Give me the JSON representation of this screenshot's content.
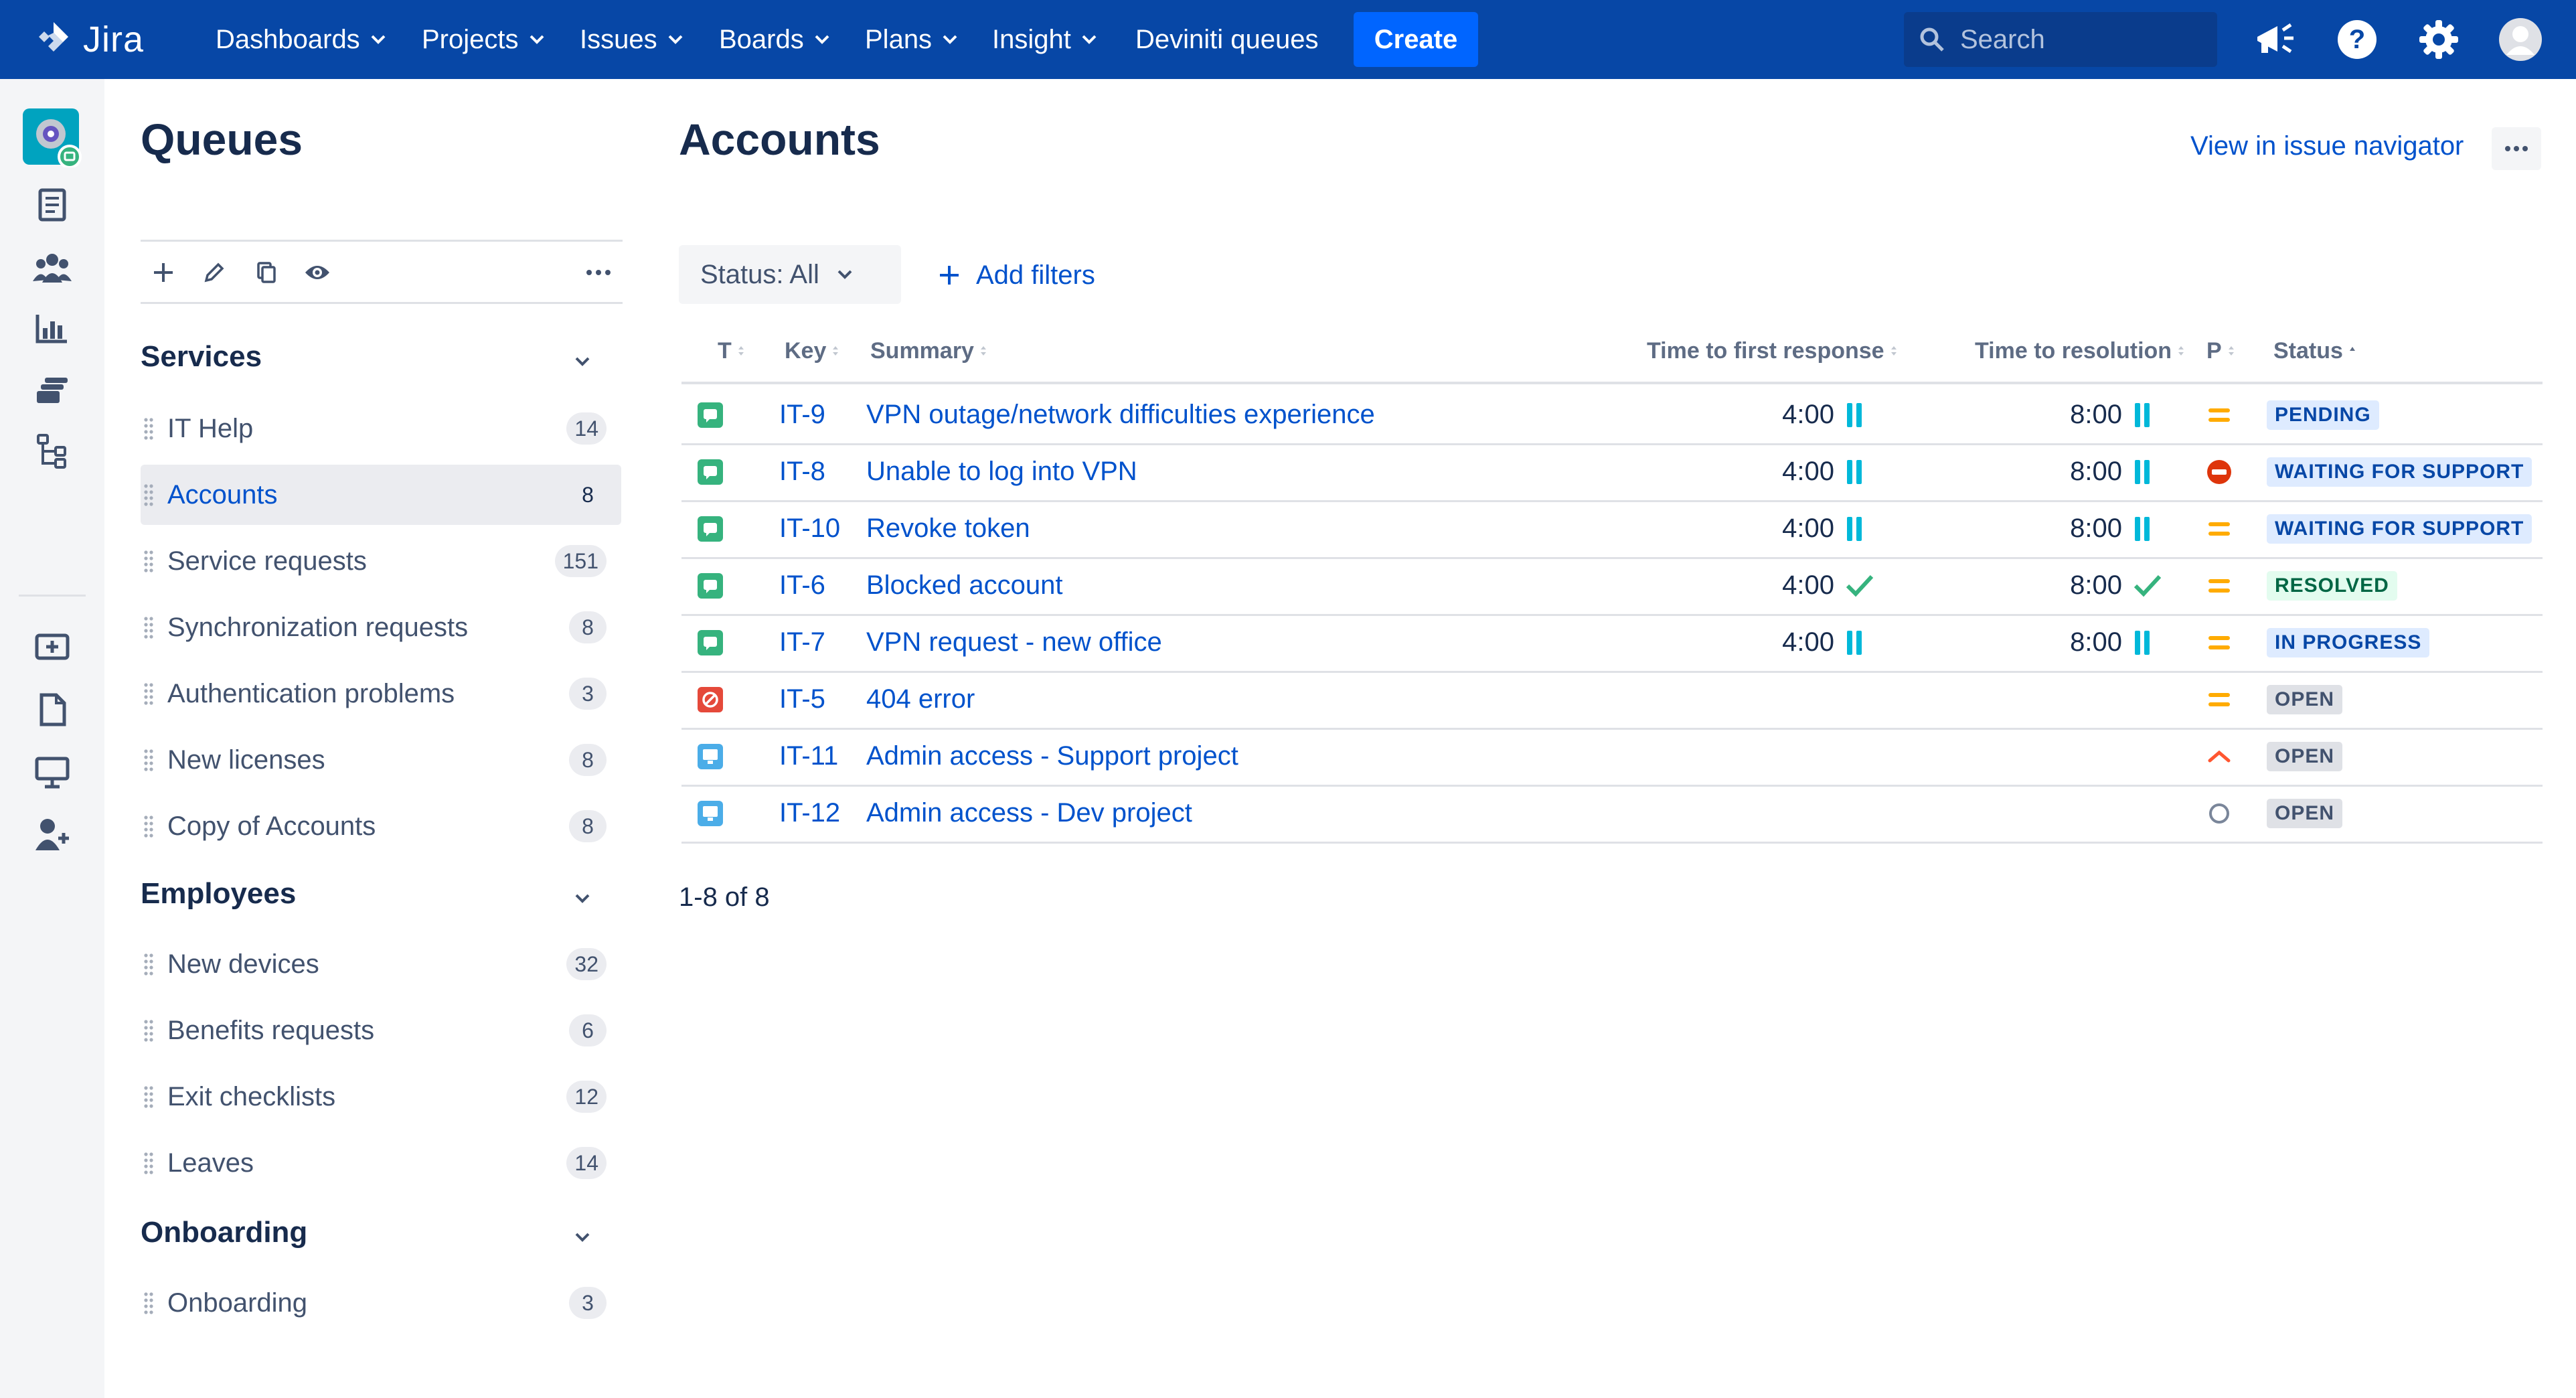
{
  "topnav": {
    "logo_text": "Jira",
    "items": [
      "Dashboards",
      "Projects",
      "Issues",
      "Boards",
      "Plans",
      "Insight"
    ],
    "queues_link": "Deviniti queues",
    "create_label": "Create",
    "search_placeholder": "Search"
  },
  "queues_panel": {
    "title": "Queues",
    "groups": [
      {
        "name": "Services",
        "items": [
          {
            "label": "IT Help",
            "count": "14"
          },
          {
            "label": "Accounts",
            "count": "8",
            "selected": true
          },
          {
            "label": "Service requests",
            "count": "151"
          },
          {
            "label": "Synchronization requests",
            "count": "8"
          },
          {
            "label": "Authentication problems",
            "count": "3"
          },
          {
            "label": "New licenses",
            "count": "8"
          },
          {
            "label": "Copy of Accounts",
            "count": "8"
          }
        ]
      },
      {
        "name": "Employees",
        "items": [
          {
            "label": "New devices",
            "count": "32"
          },
          {
            "label": "Benefits requests",
            "count": "6"
          },
          {
            "label": "Exit checklists",
            "count": "12"
          },
          {
            "label": "Leaves",
            "count": "14"
          }
        ]
      },
      {
        "name": "Onboarding",
        "items": [
          {
            "label": "Onboarding",
            "count": "3"
          }
        ]
      }
    ]
  },
  "main": {
    "title": "Accounts",
    "view_link": "View in issue navigator",
    "status_filter": "Status: All",
    "add_filters": "Add filters",
    "columns": {
      "type": "T",
      "key": "Key",
      "summary": "Summary",
      "first_response": "Time to first response",
      "resolution": "Time to resolution",
      "priority": "P",
      "status": "Status"
    },
    "rows": [
      {
        "type": "service-request",
        "key": "IT-9",
        "summary": "VPN outage/network difficulties experience",
        "first_response": "4:00",
        "fr_state": "paused",
        "resolution": "8:00",
        "res_state": "paused",
        "priority": "medium",
        "status": "PENDING",
        "status_kind": "blue"
      },
      {
        "type": "service-request",
        "key": "IT-8",
        "summary": "Unable to log into VPN",
        "first_response": "4:00",
        "fr_state": "paused",
        "resolution": "8:00",
        "res_state": "paused",
        "priority": "blocker",
        "status": "WAITING FOR SUPPORT",
        "status_kind": "blue"
      },
      {
        "type": "service-request",
        "key": "IT-10",
        "summary": "Revoke token",
        "first_response": "4:00",
        "fr_state": "paused",
        "resolution": "8:00",
        "res_state": "paused",
        "priority": "medium",
        "status": "WAITING FOR SUPPORT",
        "status_kind": "blue"
      },
      {
        "type": "service-request",
        "key": "IT-6",
        "summary": "Blocked account",
        "first_response": "4:00",
        "fr_state": "met",
        "resolution": "8:00",
        "res_state": "met",
        "priority": "medium",
        "status": "RESOLVED",
        "status_kind": "green"
      },
      {
        "type": "service-request",
        "key": "IT-7",
        "summary": "VPN request - new office",
        "first_response": "4:00",
        "fr_state": "paused",
        "resolution": "8:00",
        "res_state": "paused",
        "priority": "medium",
        "status": "IN PROGRESS",
        "status_kind": "blue"
      },
      {
        "type": "incident",
        "key": "IT-5",
        "summary": "404 error",
        "first_response": "",
        "fr_state": "none",
        "resolution": "",
        "res_state": "none",
        "priority": "medium",
        "status": "OPEN",
        "status_kind": "grey"
      },
      {
        "type": "task",
        "key": "IT-11",
        "summary": "Admin access - Support project",
        "first_response": "",
        "fr_state": "none",
        "resolution": "",
        "res_state": "none",
        "priority": "high",
        "status": "OPEN",
        "status_kind": "grey"
      },
      {
        "type": "task",
        "key": "IT-12",
        "summary": "Admin access - Dev project",
        "first_response": "",
        "fr_state": "none",
        "resolution": "",
        "res_state": "none",
        "priority": "none",
        "status": "OPEN",
        "status_kind": "grey"
      }
    ],
    "pagination": "1-8 of 8"
  },
  "colors": {
    "nav_bg": "#0747a6",
    "link": "#0052cc",
    "sla_paused": "#00b8d9",
    "sla_met": "#36b37e",
    "priority_medium": "#ffab00",
    "priority_blocker": "#de350b",
    "priority_high": "#ff5630"
  }
}
